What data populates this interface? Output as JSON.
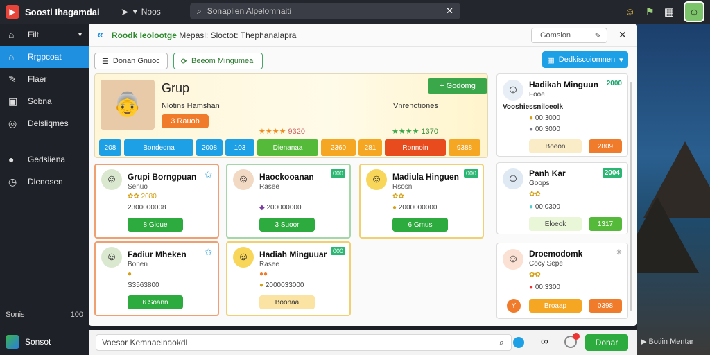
{
  "app": {
    "title": "Soostl Ihagamdai",
    "nav_label": "Noos",
    "search_value": "Sonaplien Alpelomnaiti"
  },
  "sidebar": {
    "items": [
      {
        "label": "Filt",
        "icon": "home-icon"
      },
      {
        "label": "Rrgpcoat",
        "icon": "home-icon"
      },
      {
        "label": "Flaer",
        "icon": "pin-icon"
      },
      {
        "label": "Sobna",
        "icon": "book-icon"
      },
      {
        "label": "Delsliqmes",
        "icon": "gamepad-icon"
      },
      {
        "label": "Gedsliena",
        "icon": "chat-icon"
      },
      {
        "label": "Dlenosen",
        "icon": "clock-icon"
      }
    ],
    "footer_left": "Sonis",
    "footer_right": "100",
    "bottom_label": "Sonsot"
  },
  "main": {
    "breadcrumb_green": "Roodk Ieolootge",
    "breadcrumb_rest": "Mepasl: Sloctot: Thephanalapra",
    "search_value": "Gomsion",
    "btn1": "Donan Gnuoc",
    "btn2": "Beeom Mingumeai",
    "blue_btn": "Dedkiscoiomnen"
  },
  "hero": {
    "title": "Grup",
    "sub1": "Nlotins Hamshan",
    "sub2": "Vnrenotiones",
    "pill": "3 Rauob",
    "green_btn": "+ Godomg",
    "rating1": "9320",
    "rating2": "1370",
    "tabs": [
      {
        "label": "208",
        "color": "#1ea0e6"
      },
      {
        "label": "Bondedna",
        "color": "#1ea0e6"
      },
      {
        "label": "2008",
        "color": "#1ea0e6"
      },
      {
        "label": "103",
        "color": "#1ea0e6"
      },
      {
        "label": "Dienanaa",
        "color": "#55b939"
      },
      {
        "label": "2360",
        "color": "#f5a623"
      },
      {
        "label": "281",
        "color": "#f5a623"
      },
      {
        "label": "Ronnoin",
        "color": "#e84b1d"
      },
      {
        "label": "9388",
        "color": "#f5a623"
      }
    ]
  },
  "right_cards": [
    {
      "name": "Hadikah Minguun",
      "num": "2000",
      "line1": "Fooe",
      "line2": "Vooshiessniloeolk",
      "line3": "00:3000",
      "line4": "00:3000",
      "btn": "Boeon",
      "btn2": "2809"
    },
    {
      "name": "Panh Kar",
      "num": "2004",
      "line1": "Goops",
      "line2": "00:0300",
      "btn": "Eloeok",
      "btn2": "1317"
    },
    {
      "name": "Droemodomk",
      "num": "",
      "line1": "Cocy Sepe",
      "line2": "00:3300",
      "btn": "Broaap",
      "btn2": "0398"
    }
  ],
  "grid_cards": [
    {
      "name": "Grupi Borngpuan",
      "sub": "Senuo",
      "coins": "2080",
      "stat": "2300000008",
      "btn": "8 Gioue",
      "badge": ""
    },
    {
      "name": "Haockooanan",
      "sub": "Rasee",
      "coins": "",
      "stat": "200000000",
      "btn": "3 Suoor",
      "badge": "000"
    },
    {
      "name": "Madiula Hinguen",
      "sub": "Rsosn",
      "coins": "",
      "stat": "2000000000",
      "btn": "6 Gmus",
      "badge": "000"
    },
    {
      "name": "Fadiur Mheken",
      "sub": "Bonen",
      "coins": "",
      "stat": "S3563800",
      "btn": "6 Soann",
      "badge": ""
    },
    {
      "name": "Hadiah Minguuar",
      "sub": "Rasee",
      "coins": "",
      "stat": "2000033000",
      "btn": "Boonaa",
      "badge": "000"
    }
  ],
  "footer": {
    "placeholder": "Vaesor Kemnaeinaokdl",
    "send": "Donar",
    "right_label": "Botiin Mentar"
  }
}
